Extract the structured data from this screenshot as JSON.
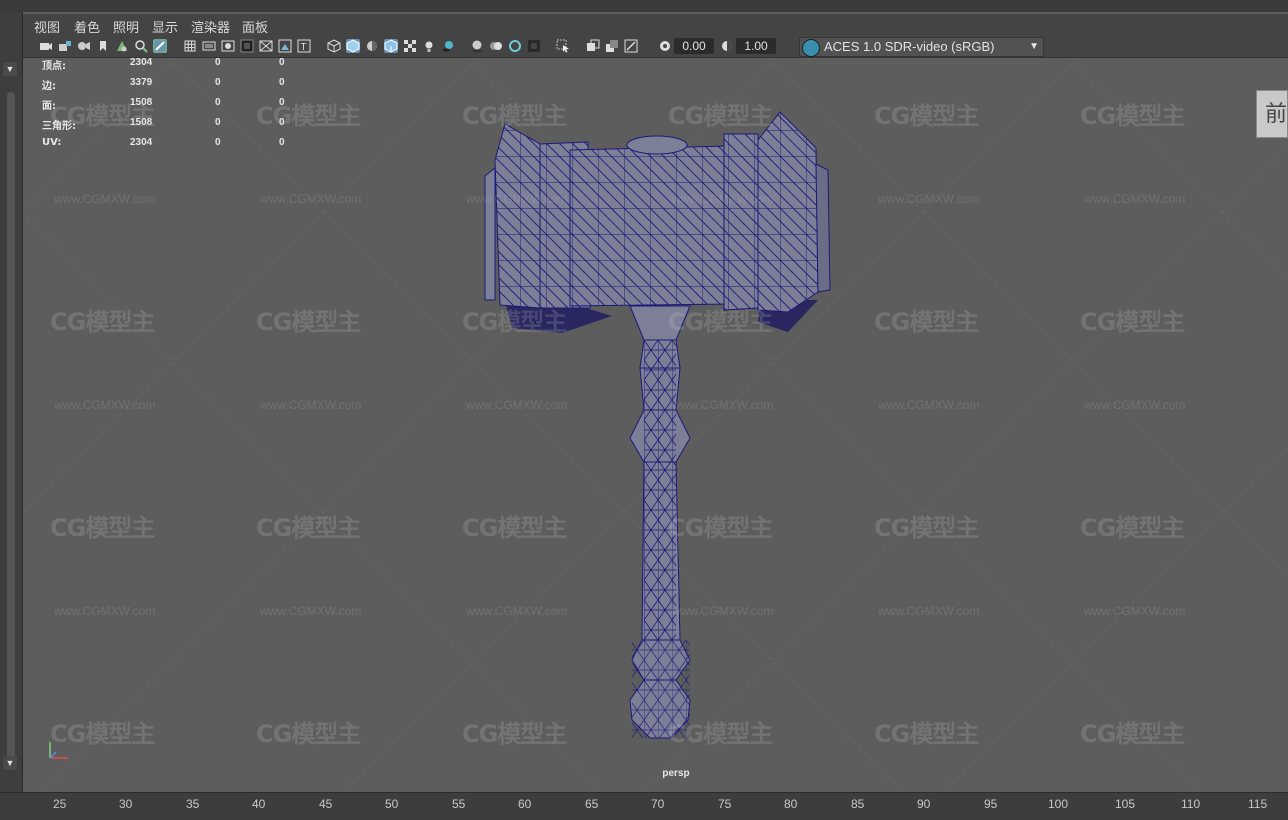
{
  "menu": [
    "视图",
    "着色",
    "照明",
    "显示",
    "渲染器",
    "面板"
  ],
  "toolbar": {
    "exposure_value": "0.00",
    "gamma_value": "1.00",
    "colorspace": "ACES 1.0 SDR-video (sRGB)"
  },
  "stats": {
    "rows": [
      {
        "label": "顶点:",
        "v1": "2304",
        "v2": "0",
        "v3": "0"
      },
      {
        "label": "边:",
        "v1": "3379",
        "v2": "0",
        "v3": "0"
      },
      {
        "label": "面:",
        "v1": "1508",
        "v2": "0",
        "v3": "0"
      },
      {
        "label": "三角形:",
        "v1": "1508",
        "v2": "0",
        "v3": "0"
      },
      {
        "label": "UV:",
        "v1": "2304",
        "v2": "0",
        "v3": "0"
      }
    ]
  },
  "viewcube_label": "前",
  "camera_label": "persp",
  "ruler_ticks": [
    "25",
    "30",
    "35",
    "40",
    "45",
    "50",
    "55",
    "60",
    "65",
    "70",
    "75",
    "80",
    "85",
    "90",
    "95",
    "100",
    "105",
    "110",
    "115"
  ],
  "watermark": {
    "logo": "CG模型主",
    "url": "www.CGMXW.com"
  },
  "colors": {
    "wireframe": "#1c1a78",
    "mesh_fill": "#7d7f97",
    "viewport": "#5d5d5d"
  }
}
